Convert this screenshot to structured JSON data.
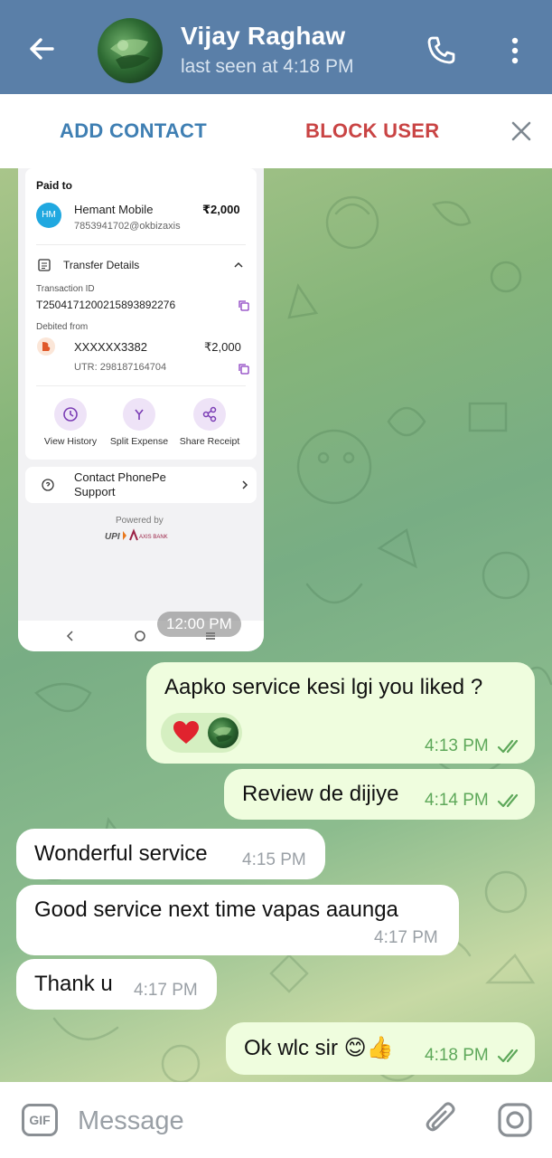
{
  "header": {
    "contact_name": "Vijay Raghaw",
    "status": "last seen at 4:18 PM"
  },
  "action_bar": {
    "add_contact": "ADD CONTACT",
    "block_user": "BLOCK USER"
  },
  "payment_screenshot": {
    "paid_to_label": "Paid to",
    "payee_initials": "HM",
    "payee_name": "Hemant Mobile",
    "payee_upi": "7853941702@okbizaxis",
    "amount": "₹2,000",
    "transfer_details_label": "Transfer Details",
    "transaction_id_label": "Transaction ID",
    "transaction_id": "T2504171200215893892276",
    "debited_from_label": "Debited from",
    "account": "XXXXXX3382",
    "debited_amount": "₹2,000",
    "utr": "UTR: 298187164704",
    "actions": [
      "View History",
      "Split Expense",
      "Share Receipt"
    ],
    "support_label": "Contact PhonePe Support",
    "powered_by": "Powered by",
    "time": "12:00 PM"
  },
  "messages": [
    {
      "direction": "out",
      "text": "Aapko service kesi lgi you liked ?",
      "time": "4:13 PM",
      "reactions": [
        "heart",
        "avatar"
      ]
    },
    {
      "direction": "out",
      "text": "Review de dijiye",
      "time": "4:14 PM"
    },
    {
      "direction": "in",
      "text": "Wonderful service",
      "time": "4:15 PM"
    },
    {
      "direction": "in",
      "text": "Good service next time vapas aaunga",
      "time": "4:17 PM"
    },
    {
      "direction": "in",
      "text": "Thank u",
      "time": "4:17 PM"
    },
    {
      "direction": "out",
      "text": "Ok wlc sir 😊👍",
      "time": "4:18 PM"
    }
  ],
  "input": {
    "gif_label": "GIF",
    "placeholder": "Message"
  },
  "colors": {
    "header_bg": "#5a7fa8",
    "add_contact": "#3f7fb3",
    "block_user": "#c94444",
    "outgoing_bubble": "#effdde",
    "outgoing_time": "#5ea85a"
  },
  "icons": [
    "back-arrow-icon",
    "phone-icon",
    "more-vertical-icon",
    "close-icon",
    "history-icon",
    "split-icon",
    "share-icon",
    "support-icon",
    "chevron-right-icon",
    "double-check-icon",
    "heart-icon",
    "paperclip-icon",
    "instagram-camera-icon"
  ]
}
